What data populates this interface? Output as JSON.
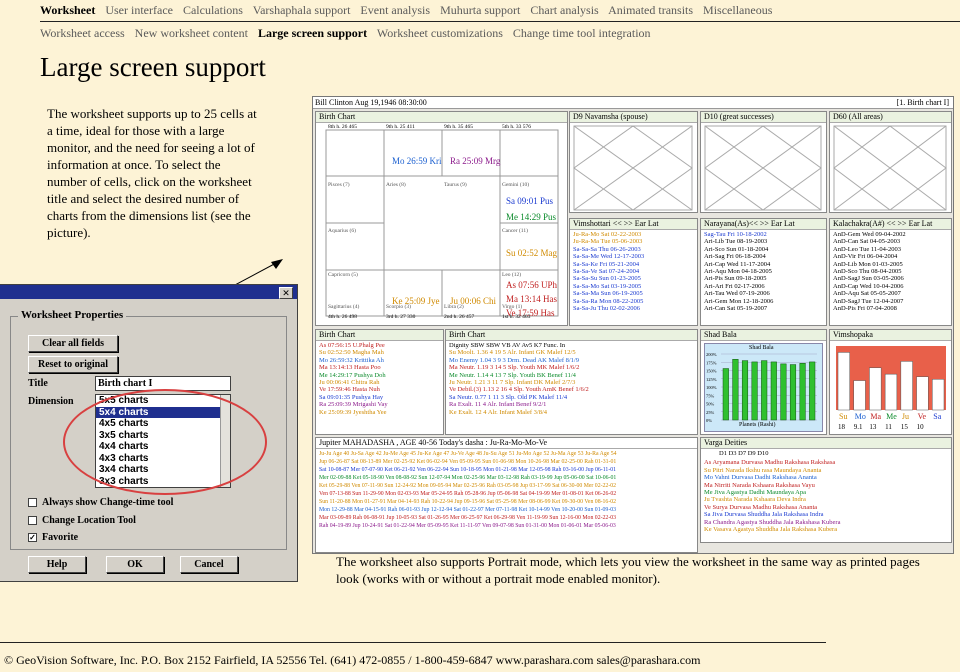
{
  "nav": {
    "main": [
      {
        "label": "Worksheet",
        "active": true
      },
      {
        "label": "User interface",
        "active": false
      },
      {
        "label": "Calculations",
        "active": false
      },
      {
        "label": "Varshaphala support",
        "active": false
      },
      {
        "label": "Event analysis",
        "active": false
      },
      {
        "label": "Muhurta support",
        "active": false
      },
      {
        "label": "Chart analysis",
        "active": false
      },
      {
        "label": "Animated transits",
        "active": false
      },
      {
        "label": "Miscellaneous",
        "active": false
      }
    ],
    "sub": [
      {
        "label": "Worksheet access",
        "active": false
      },
      {
        "label": "New worksheet content",
        "active": false
      },
      {
        "label": "Large screen support",
        "active": true
      },
      {
        "label": "Worksheet customizations",
        "active": false
      },
      {
        "label": "Change time tool integration",
        "active": false
      }
    ]
  },
  "page_title": "Large screen support",
  "description": "The worksheet supports up to 25 cells at a time, ideal for those with a large monitor, and the need for seeing a lot of information at once. To select the number of cells, click on the worksheet title and select the desired number of charts from the dimensions list (see the picture).",
  "dialog": {
    "group_label": "Worksheet Properties",
    "clear_button": "Clear all fields",
    "reset_button": "Reset to original",
    "title_label": "Title",
    "title_value": "Birth chart I",
    "dimension_label": "Dimension",
    "dimension_options": [
      "5x5 charts",
      "5x4 charts",
      "4x5 charts",
      "3x5 charts",
      "4x4 charts",
      "4x3 charts",
      "3x4 charts",
      "3x3 charts"
    ],
    "selected_option": "5x4 charts",
    "checkbox_change_time": "Always show Change-time tool",
    "checkbox_location": "Change Location Tool",
    "checkbox_favorite": "Favorite",
    "help_button": "Help",
    "ok_button": "OK",
    "cancel_button": "Cancel",
    "close_glyph": "✕"
  },
  "worksheet": {
    "header_left": "Bill Clinton  Aug 19,1946 08:30:00",
    "header_right": "[1. Birth chart I]",
    "birth_chart_title": "Birth Chart",
    "birth_chart_cells": [
      {
        "text": "8th h.  26  465",
        "color": "#000"
      },
      {
        "text": "9th h.  25  411",
        "color": "#000"
      },
      {
        "text": "9th h.  35  465",
        "color": "#000"
      },
      {
        "text": "5th h.  33  576",
        "color": "#000"
      },
      {
        "text": "Mo 26:59 Kri",
        "color": "#1a5fd0"
      },
      {
        "text": "Ra 25:09 Mrg",
        "color": "#8b1a8b"
      },
      {
        "text": "Sa 09:01 Pus",
        "color": "#1a3ad0"
      },
      {
        "text": "Me 14:29 Pus",
        "color": "#0a8a2a"
      },
      {
        "text": "Su 02:52 Mag",
        "color": "#d08a00"
      },
      {
        "text": "As 07:56 UPh",
        "color": "#c02020"
      },
      {
        "text": "Ma 13:14 Has",
        "color": "#c02020"
      },
      {
        "text": "Ve 17:59 Has",
        "color": "#c02020"
      },
      {
        "text": "Ke 25:09 Jye",
        "color": "#d08a00"
      },
      {
        "text": "Ju 00:06 Chi",
        "color": "#d08a00"
      },
      {
        "text": "Pisces (7)",
        "color": "#555"
      },
      {
        "text": "Aries (8)",
        "color": "#555"
      },
      {
        "text": "Taurus (9)",
        "color": "#555"
      },
      {
        "text": "Gemini (10)",
        "color": "#555"
      },
      {
        "text": "Aquarius (6)",
        "color": "#555"
      },
      {
        "text": "Cancer (11)",
        "color": "#555"
      },
      {
        "text": "Capricorn (5)",
        "color": "#555"
      },
      {
        "text": "Leo (12)",
        "color": "#555"
      },
      {
        "text": "Sagittarius (4)",
        "color": "#555"
      },
      {
        "text": "Scorpio (3)",
        "color": "#555"
      },
      {
        "text": "Libra (2)",
        "color": "#555"
      },
      {
        "text": "Virgo (1)",
        "color": "#555"
      },
      {
        "text": "4th h.  26  498",
        "color": "#000"
      },
      {
        "text": "3rd h.  27  330",
        "color": "#000"
      },
      {
        "text": "2nd h.  26  457",
        "color": "#000"
      },
      {
        "text": "1st h.  32  463",
        "color": "#000"
      }
    ],
    "d9_title": "D9 Navamsha  (spouse)",
    "d10_title": "D10  (great successes)",
    "d60_title": "D60  (All areas)",
    "vim_title": "Vimshottari     << >> Ear Lat",
    "vim_rows": [
      "Ju-Ra-Mo Sat 02-22-2003",
      "Ju-Ra-Ma Tue 05-06-2003",
      "Sa-Sa-Sa Thu 06-26-2003",
      "Sa-Sa-Me Wed 12-17-2003",
      "Sa-Sa-Ke Fri 05-21-2004",
      "Sa-Sa-Ve Sat 07-24-2004",
      "Sa-Sa-Su Sun 01-23-2005",
      "Sa-Sa-Mo Sat 03-19-2005",
      "Sa-Sa-Ma Sun 06-19-2005",
      "Sa-Sa-Ra Mon 08-22-2005",
      "Sa-Sa-Ju Thu 02-02-2006"
    ],
    "nar_title": "Narayana(As)<< >> Ear Lat",
    "nar_rows": [
      "Sag-Tau Fri 10-18-2002",
      "Ari-Lib Tue 08-19-2003",
      "Ari-Sco Sun 01-18-2004",
      "Ari-Sag Fri 06-18-2004",
      "Ari-Cap Wed 11-17-2004",
      "Ari-Aqu Mon 04-18-2005",
      "Ari-Pis Sun 09-18-2005",
      "Ari-Ari Fri 02-17-2006",
      "Ari-Tau Wed 07-19-2006",
      "Ari-Gem Mon 12-18-2006",
      "Ari-Can Sat 05-19-2007"
    ],
    "kal_title": "Kalachakra(A#) << >> Ear Lat",
    "kal_rows": [
      "AnD-Gem Wed 09-04-2002",
      "AnD-Can Sat 04-05-2003",
      "AnD-Leo Tue 11-04-2003",
      "AnD-Vir Fri 06-04-2004",
      "AnD-Lib Mon 01-03-2005",
      "AnD-Sco Thu 08-04-2005",
      "AnD-SagJ Sun 03-05-2006",
      "AnD-Cap Wed 10-04-2006",
      "AnD-Aqu Sat 05-05-2007",
      "AnD-SagJ Tue 12-04-2007",
      "AnD-Pis Fri 07-04-2008"
    ],
    "bc2_title": "Birth Chart",
    "bc2_rows": [
      "As 07:56:15 U.Phalg Pee",
      "Su 02:52:50 Magha Mah",
      "Mo 26:59:32 Krittika Ah",
      "Ma 13:14:13 Hasta Poo",
      "Me 14:29:17 Pushya Doh",
      "Ju 00:06:41 Chitra Rah",
      "Ve 17:59:46 Hasta Nuh",
      "Sa 09:01:35 Pushya Hay",
      "Ra 25:09:39 Mrigashi Vay",
      "Ke 25:09:39 Jyeshtha Yee"
    ],
    "bc3_title": "Birth Chart",
    "bc3_rows": [
      "Dignity SBW SBW VB AV Av5 K7 Func. In",
      "Su Moolt. 1.36 4 19 5 Alr. Infant GK Malef 12/5",
      "Mo Enemy 1.04 3 9 3 Drm. Dead AK Malef 8/1/9",
      "Ma Neutr. 1.19 3 14 5 Slp. Youth MK Malef 1/6/2",
      "Me Neutr. 1.14 4 13 7 Slp. Youth BK Benef 11/4",
      "Ju Neutr. 1.21 3 11 7 Slp. Infant DK Malef 2/7/3",
      "Ve Debil.(3) 1.13 2 16 4 Slp. Youth AmK Benef 1/6/2",
      "Sa Neutr. 0.77 1 11 3 Slp. Old PK Malef 11/4",
      "Ra Exalt. 11 4 Alr. Infant Benef 9/2/1",
      "Ke Exalt. 12 4 Alr. Infant Malef 3/8/4"
    ],
    "shad_title": "Shad Bala",
    "shad_chart_title": "Shad Bala",
    "shad_xlabel": "Planets (Rashi)",
    "shad_ticks": [
      "200%",
      "175%",
      "150%",
      "125%",
      "100%",
      "75%",
      "50%",
      "25%",
      "0%"
    ],
    "vim2_title": "Vimshopaka",
    "vim2_labels": [
      "Su",
      "Mo",
      "Ma",
      "Me",
      "Ju",
      "Ve",
      "Sa"
    ],
    "vim2_values": [
      "18",
      "9.1",
      "13",
      "11",
      "15",
      "10"
    ],
    "maha_header": "Jupiter MAHADASHA , AGE 40-56         Today's dasha : Ju-Ra-Mo-Mo-Ve",
    "maha_rows": [
      "Ju-Ju Age 40 Ju-Sa Age 42 Ju-Me Age 45 Ju-Ke Age 47 Ju-Ve Age 48 Ju-Su Age 51 Ju-Mo Age 52 Ju-Ma Age 53 Ju-Ra Age 54",
      "Jup 06-26-87 Sat 08-13-89 Mer 02-25-92 Ket 06-02-94 Ven 05-09-95 Sun 01-06-98 Mon 10-26-98 Mar 02-25-00 Rah 01-31-01",
      "Sat 10-08-87 Mer 07-07-90 Ket 06-21-92 Ven 06-22-94 Sun 10-18-95 Mon 01-21-98 Mar 12-05-98 Rah 03-16-00 Jup 06-11-01",
      "Mer 02-09-88 Ket 05-18-90 Ven 08-08-92 Sun 12-07-94 Mon 02-25-96 Mar 03-12-98 Rah 03-19-99 Jup 05-06-00 Sat 10-06-01",
      "Ket 05-29-88 Ven 07-11-90 Sun 12-24-92 Mon 09-05-94 Mar 02-25-96 Rah 03-05-98 Jup 03-17-99 Sat 06-30-00 Mer 02-22-02",
      "Ven 07-13-88 Sun 11-29-90 Mon 02-03-93 Mar 05-24-95 Rah 05-28-96 Jup 05-06-98 Sat 04-19-99 Mer 01-08-01 Ket 06-26-02",
      "Sun 11-20-88 Mon 01-27-91 Mar 04-14-93 Rah 10-22-94 Jup 09-15-96 Sat 05-25-98 Mer 08-06-99 Ket 09-30-00 Ven 08-16-02",
      "Mon 12-29-88 Mar 04-15-91 Rah 06-01-93 Jup 12-12-94 Sat 01-22-97 Mer 07-11-98 Ket 10-14-99 Ven 10-20-00 Sun 01-09-03",
      "Mar 03-09-89 Rah 06-08-91 Jup 10-05-93 Sat 01-26-95 Mer 06-25-97 Ket 06-29-98 Ven 11-19-99 Sun 12-16-00 Mon 02-22-03",
      "Rah 04-19-89 Jup 10-24-91 Sat 01-22-94 Mer 05-09-95 Ket 11-11-97 Ven 09-07-98 Sun 01-31-00 Mon 01-06-01 Mar 05-06-03"
    ],
    "varga_title": "Varga Deities",
    "varga_header": "D1    D3     D7     D9    D10",
    "varga_rows": [
      "As Aryamana Durvasa Madhu Rakshasa Rakshasa",
      "Su Pitri Narada Ikshu rasa Maundaya Ananta",
      "Mo Vahni Durvasa Dadhi Rakshasa Ananta",
      "Ma Nirriti Narada Kshaara Rakshasa Vayu",
      "Me Jiva Agastya Dadhi Maundaya Apa",
      "Ju Tvashta Narada Kshaara Deva Indra",
      "Ve Surya Durvasa Madhu Rakshasa Ananta",
      "Sa Jiva Durvasa Shuddha Jala Rakshasa Indra",
      "Ra Chandra Agastya Shuddha Jala Rakshasa Kubera",
      "Ke Vasava Agastya Shuddha Jala Rakshasa Kubera"
    ]
  },
  "shad_bars": [
    0.78,
    0.92,
    0.9,
    0.88,
    0.9,
    0.88,
    0.85,
    0.84,
    0.86,
    0.88
  ],
  "vim2_bars": [
    0.9,
    0.46,
    0.66,
    0.56,
    0.76,
    0.52,
    0.48
  ],
  "caption": "The worksheet also supports Portrait mode, which lets you view the worksheet in the same way as printed pages look (works with or without a portrait mode enabled monitor).",
  "footer": "© GeoVision Software, Inc. P.O. Box 2152 Fairfield, IA 52556     Tel. (641) 472-0855 / 1-800-459-6847     www.parashara.com     sales@parashara.com"
}
